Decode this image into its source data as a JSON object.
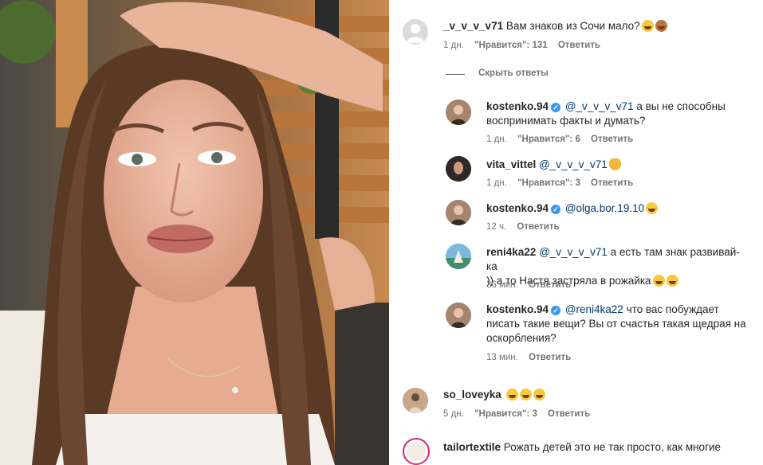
{
  "comments": [
    {
      "user": "_v_v_v_v71",
      "text": "Вам знаков из Сочи мало?",
      "time": "1 дн.",
      "likes": "\"Нравится\": 131",
      "reply": "Ответить",
      "emojis": [
        "sweat-smile-emoji",
        "see-no-evil-monkey-emoji"
      ]
    },
    {
      "user": "kostenko.94",
      "mention": "@_v_v_v_v71",
      "text1": " а вы не способны",
      "text2": "воспринимать факты и думать?",
      "time": "1 дн.",
      "likes": "\"Нравится\": 6",
      "reply": "Ответить"
    },
    {
      "user": "vita_vittel",
      "mention": "@_v_v_v_v71",
      "time": "1 дн.",
      "likes": "\"Нравится\": 3",
      "reply": "Ответить"
    },
    {
      "user": "kostenko.94",
      "mention": "@olga.bor.19.10",
      "time": "12 ч.",
      "reply": "Ответить"
    },
    {
      "user": "reni4ka22",
      "mention": "@_v_v_v_v71",
      "text1": " а есть там знак развивай-ка",
      "text2": ")) а то Настя застряла в рожайка",
      "time": "36 мин.",
      "reply": "Ответить"
    },
    {
      "user": "kostenko.94",
      "mention": "@reni4ka22",
      "text1": " что вас побуждает",
      "text2": "писать такие вещи? Вы от счастья такая щедрая на",
      "text3": "оскорбления?",
      "time": "13 мин.",
      "reply": "Ответить"
    },
    {
      "user": "so_loveyka",
      "time": "5 дн.",
      "likes": "\"Нравится\": 3",
      "reply": "Ответить"
    },
    {
      "user": "tailortextile",
      "text": "Рожать детей это не так просто, как многие"
    }
  ],
  "hide_replies": "Скрыть ответы",
  "verified_mark": "✓"
}
